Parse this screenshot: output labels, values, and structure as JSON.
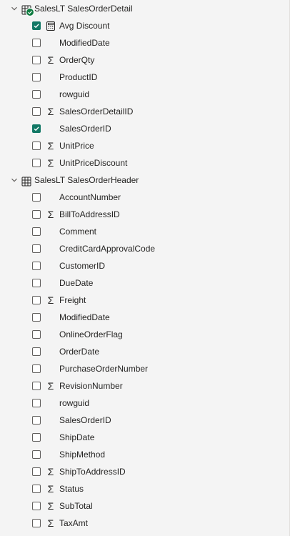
{
  "tables": [
    {
      "name": "SalesLT SalesOrderDetail",
      "expanded": true,
      "has_selection_badge": true,
      "fields": [
        {
          "label": "Avg Discount",
          "checked": true,
          "icon": "calculator-icon"
        },
        {
          "label": "ModifiedDate",
          "checked": false,
          "icon": ""
        },
        {
          "label": "OrderQty",
          "checked": false,
          "icon": "sigma-icon"
        },
        {
          "label": "ProductID",
          "checked": false,
          "icon": ""
        },
        {
          "label": "rowguid",
          "checked": false,
          "icon": ""
        },
        {
          "label": "SalesOrderDetailID",
          "checked": false,
          "icon": "sigma-icon"
        },
        {
          "label": "SalesOrderID",
          "checked": true,
          "icon": ""
        },
        {
          "label": "UnitPrice",
          "checked": false,
          "icon": "sigma-icon"
        },
        {
          "label": "UnitPriceDiscount",
          "checked": false,
          "icon": "sigma-icon"
        }
      ]
    },
    {
      "name": "SalesLT SalesOrderHeader",
      "expanded": true,
      "has_selection_badge": false,
      "fields": [
        {
          "label": "AccountNumber",
          "checked": false,
          "icon": ""
        },
        {
          "label": "BillToAddressID",
          "checked": false,
          "icon": "sigma-icon"
        },
        {
          "label": "Comment",
          "checked": false,
          "icon": ""
        },
        {
          "label": "CreditCardApprovalCode",
          "checked": false,
          "icon": ""
        },
        {
          "label": "CustomerID",
          "checked": false,
          "icon": ""
        },
        {
          "label": "DueDate",
          "checked": false,
          "icon": ""
        },
        {
          "label": "Freight",
          "checked": false,
          "icon": "sigma-icon"
        },
        {
          "label": "ModifiedDate",
          "checked": false,
          "icon": ""
        },
        {
          "label": "OnlineOrderFlag",
          "checked": false,
          "icon": ""
        },
        {
          "label": "OrderDate",
          "checked": false,
          "icon": ""
        },
        {
          "label": "PurchaseOrderNumber",
          "checked": false,
          "icon": ""
        },
        {
          "label": "RevisionNumber",
          "checked": false,
          "icon": "sigma-icon"
        },
        {
          "label": "rowguid",
          "checked": false,
          "icon": ""
        },
        {
          "label": "SalesOrderID",
          "checked": false,
          "icon": ""
        },
        {
          "label": "ShipDate",
          "checked": false,
          "icon": ""
        },
        {
          "label": "ShipMethod",
          "checked": false,
          "icon": ""
        },
        {
          "label": "ShipToAddressID",
          "checked": false,
          "icon": "sigma-icon"
        },
        {
          "label": "Status",
          "checked": false,
          "icon": "sigma-icon"
        },
        {
          "label": "SubTotal",
          "checked": false,
          "icon": "sigma-icon"
        },
        {
          "label": "TaxAmt",
          "checked": false,
          "icon": "sigma-icon"
        }
      ]
    }
  ],
  "colors": {
    "checkbox_checked": "#117865",
    "badge": "#107c41",
    "background": "#f4f4f4",
    "text": "#252423"
  }
}
